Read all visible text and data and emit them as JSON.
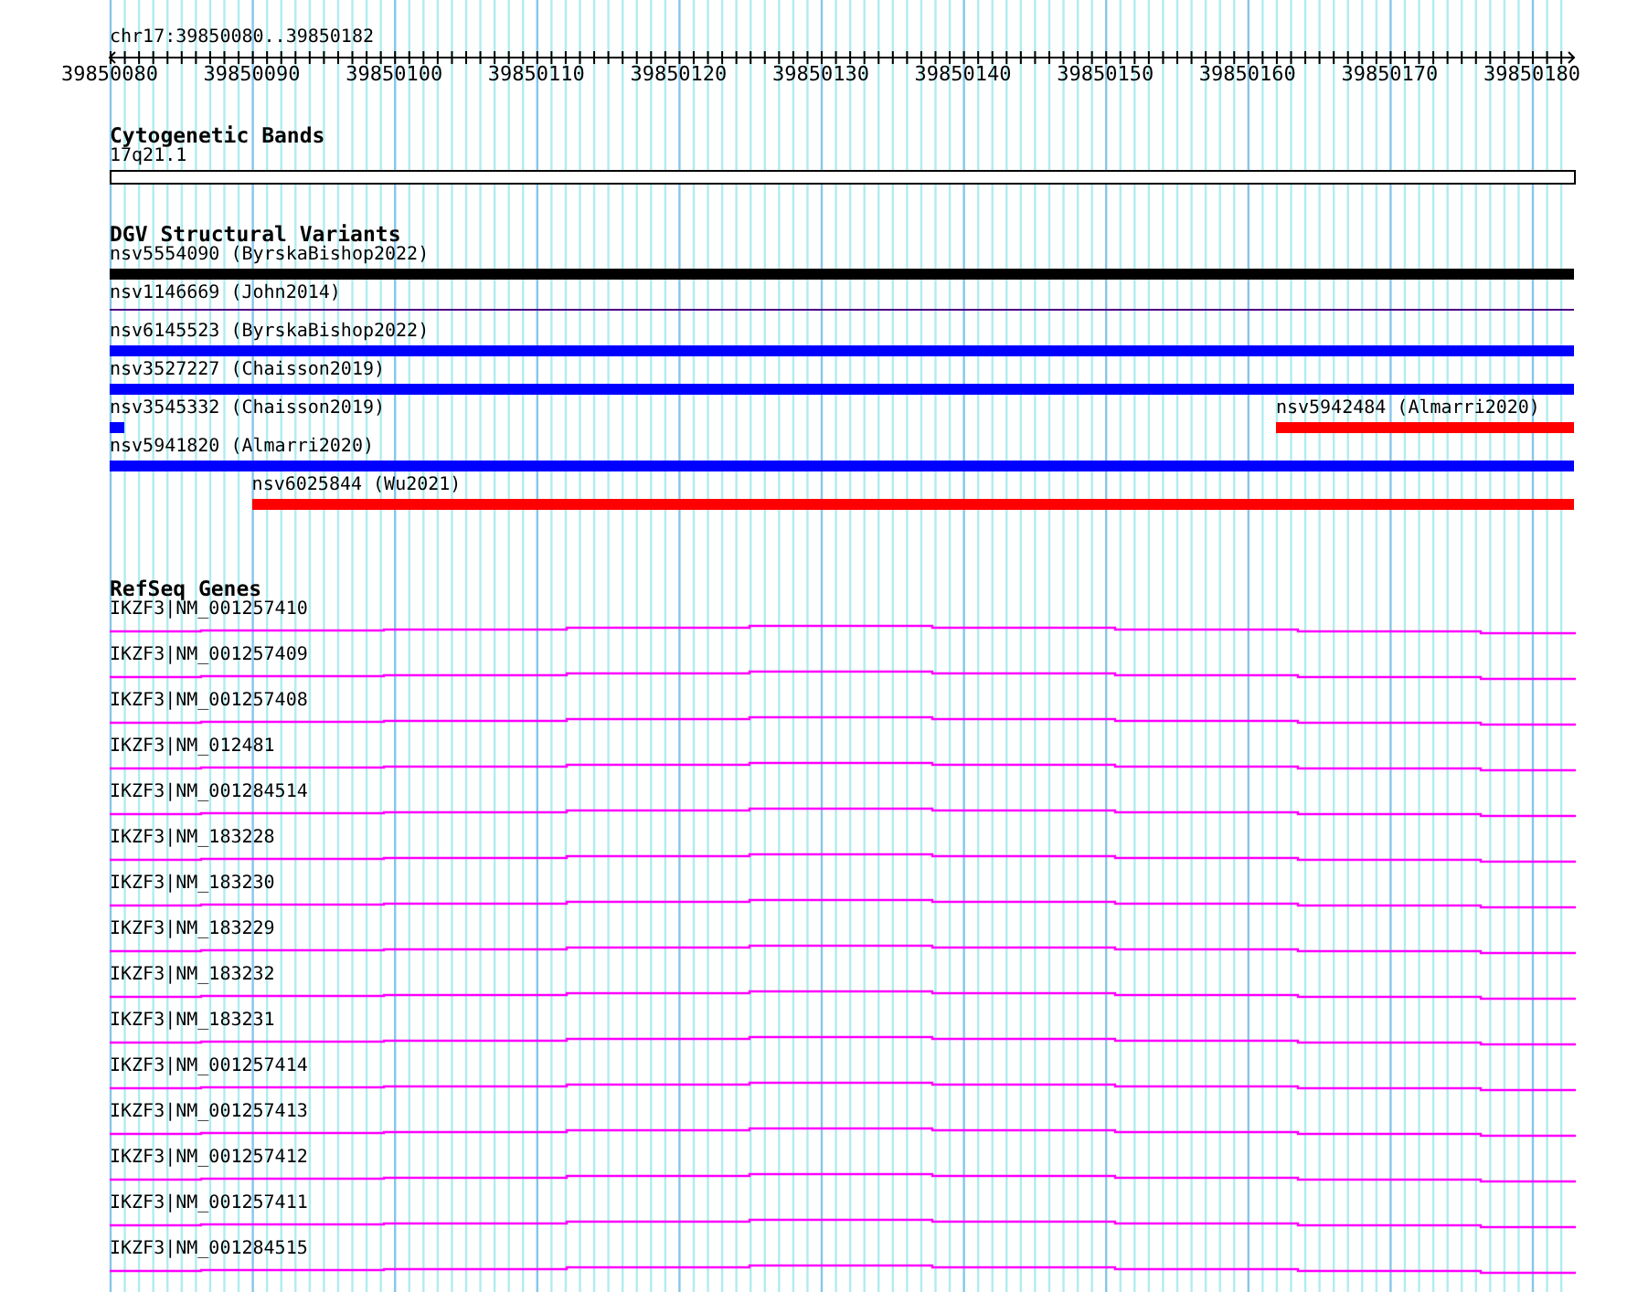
{
  "location": "chr17:39850080..39850182",
  "ruler": {
    "labels": [
      "39850080",
      "39850090",
      "39850100",
      "39850110",
      "39850120",
      "39850130",
      "39850140",
      "39850150",
      "39850160",
      "39850170",
      "39850180"
    ]
  },
  "tracks": [
    {
      "kind": "bands",
      "title": "Cytogenetic Bands",
      "features": [
        {
          "label": "17q21.1"
        }
      ]
    },
    {
      "kind": "variants",
      "title": "DGV Structural Variants",
      "lanes": [
        [
          {
            "label": "nsv5554090 (ByrskaBishop2022)",
            "kind": "bar",
            "color": "#000000"
          }
        ],
        [
          {
            "label": "nsv1146669 (John2014)",
            "kind": "thin",
            "color": "#4b0082"
          }
        ],
        [
          {
            "label": "nsv6145523 (ByrskaBishop2022)",
            "kind": "bar",
            "color": "#0000ff"
          }
        ],
        [
          {
            "label": "nsv3527227 (Chaisson2019)",
            "kind": "bar",
            "color": "#0000ff"
          }
        ],
        [
          {
            "label": "nsv3545332 (Chaisson2019)",
            "kind": "bar",
            "color": "#0000ff"
          },
          {
            "label": "nsv5942484 (Almarri2020)",
            "kind": "bar",
            "color": "#ff0000"
          }
        ],
        [
          {
            "label": "nsv5941820 (Almarri2020)",
            "kind": "bar",
            "color": "#0000ff"
          }
        ],
        [
          {
            "label": "nsv6025844 (Wu2021)",
            "kind": "bar",
            "color": "#ff0000"
          }
        ]
      ]
    },
    {
      "kind": "genes",
      "title": "RefSeq Genes",
      "features": [
        {
          "label": "IKZF3|NM_001257410"
        },
        {
          "label": "IKZF3|NM_001257409"
        },
        {
          "label": "IKZF3|NM_001257408"
        },
        {
          "label": "IKZF3|NM_012481"
        },
        {
          "label": "IKZF3|NM_001284514"
        },
        {
          "label": "IKZF3|NM_183228"
        },
        {
          "label": "IKZF3|NM_183230"
        },
        {
          "label": "IKZF3|NM_183229"
        },
        {
          "label": "IKZF3|NM_183232"
        },
        {
          "label": "IKZF3|NM_183231"
        },
        {
          "label": "IKZF3|NM_001257414"
        },
        {
          "label": "IKZF3|NM_001257413"
        },
        {
          "label": "IKZF3|NM_001257412"
        },
        {
          "label": "IKZF3|NM_001257411"
        },
        {
          "label": "IKZF3|NM_001284515"
        }
      ]
    }
  ]
}
